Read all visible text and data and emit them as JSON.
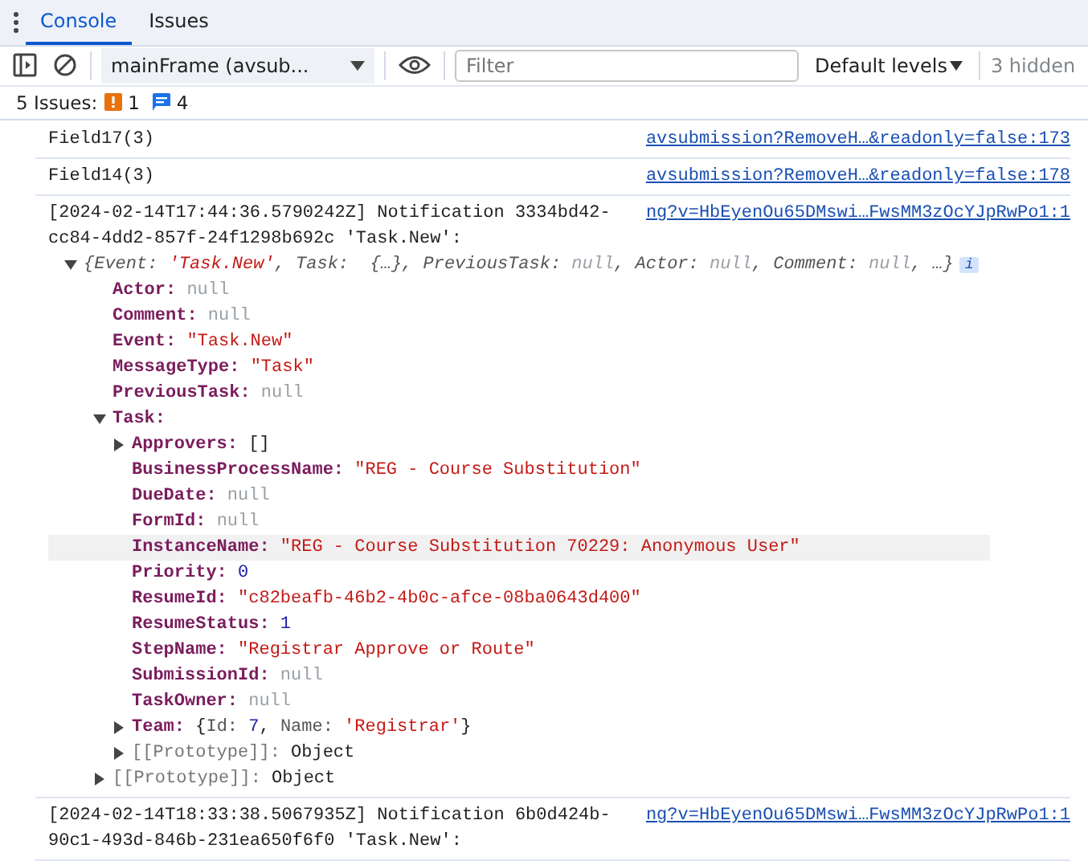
{
  "tabs": [
    {
      "label": "Console",
      "selected": true
    },
    {
      "label": "Issues",
      "selected": false
    }
  ],
  "toolbar": {
    "context": "mainFrame (avsub...",
    "filter_placeholder": "Filter",
    "levels": "Default levels",
    "hidden": "3 hidden"
  },
  "issues": {
    "label": "5 Issues:",
    "errors": "1",
    "infos": "4"
  },
  "messages": [
    {
      "kind": "log",
      "text": "Field17(3)",
      "source": "avsubmission?RemoveH…&readonly=false:173"
    },
    {
      "kind": "log",
      "text": "Field14(3)",
      "source": "avsubmission?RemoveH…&readonly=false:178"
    },
    {
      "kind": "object",
      "text": "[2024-02-14T17:44:36.5790242Z] Notification 3334bd42-cc84-4dd2-857f-24f1298b692c 'Task.New':",
      "source": "ng?v=HbEyenOu65DMswi…FwsMM3zOcYJpRwPo1:1",
      "expanded": true,
      "preview": [
        {
          "text": "{",
          "kind": "punct"
        },
        {
          "text": "Event:",
          "kind": "pkey"
        },
        {
          "text": "'Task.New'",
          "kind": "string"
        },
        {
          "text": ", ",
          "kind": "punct"
        },
        {
          "text": "Task:",
          "kind": "pkey"
        },
        {
          "text": " {…}, ",
          "kind": "punct"
        },
        {
          "text": "PreviousTask:",
          "kind": "pkey"
        },
        {
          "text": "null",
          "kind": "null"
        },
        {
          "text": ", ",
          "kind": "punct"
        },
        {
          "text": "Actor:",
          "kind": "pkey"
        },
        {
          "text": "null",
          "kind": "null"
        },
        {
          "text": ", ",
          "kind": "punct"
        },
        {
          "text": "Comment:",
          "kind": "pkey"
        },
        {
          "text": "null",
          "kind": "null"
        },
        {
          "text": ", …}",
          "kind": "punct"
        }
      ],
      "info_badge": "i",
      "tree": [
        {
          "key": "Actor:",
          "value": "null",
          "kind": "null"
        },
        {
          "key": "Comment:",
          "value": "null",
          "kind": "null"
        },
        {
          "key": "Event:",
          "value": "\"Task.New\"",
          "kind": "string"
        },
        {
          "key": "MessageType:",
          "value": "\"Task\"",
          "kind": "string"
        },
        {
          "key": "PreviousTask:",
          "value": "null",
          "kind": "null"
        },
        {
          "key": "Task:",
          "kind": "object",
          "expanded": true,
          "children": [
            {
              "key": "Approvers:",
              "value": "[]",
              "kind": "object",
              "expanded": false
            },
            {
              "key": "BusinessProcessName:",
              "value": "\"REG - Course Substitution\"",
              "kind": "string"
            },
            {
              "key": "DueDate:",
              "value": "null",
              "kind": "null"
            },
            {
              "key": "FormId:",
              "value": "null",
              "kind": "null"
            },
            {
              "key": "InstanceName:",
              "value": "\"REG - Course Substitution 70229: Anonymous User\"",
              "kind": "string",
              "highlighted": true
            },
            {
              "key": "Priority:",
              "value": "0",
              "kind": "number"
            },
            {
              "key": "ResumeId:",
              "value": "\"c82beafb-46b2-4b0c-afce-08ba0643d400\"",
              "kind": "string"
            },
            {
              "key": "ResumeStatus:",
              "value": "1",
              "kind": "number"
            },
            {
              "key": "StepName:",
              "value": "\"Registrar Approve or Route\"",
              "kind": "string"
            },
            {
              "key": "SubmissionId:",
              "value": "null",
              "kind": "null"
            },
            {
              "key": "TaskOwner:",
              "value": "null",
              "kind": "null"
            },
            {
              "key": "Team:",
              "kind": "object",
              "expanded": false,
              "parts": [
                {
                  "text": "{",
                  "kind": "punct"
                },
                {
                  "text": "Id:",
                  "kind": "pkey"
                },
                {
                  "text": "7",
                  "kind": "number"
                },
                {
                  "text": ", ",
                  "kind": "punct"
                },
                {
                  "text": "Name:",
                  "kind": "pkey"
                },
                {
                  "text": "'Registrar'",
                  "kind": "string"
                },
                {
                  "text": "}",
                  "kind": "punct"
                }
              ]
            },
            {
              "key": "[[Prototype]]:",
              "value": "Object",
              "kind": "proto",
              "expanded": false
            }
          ]
        },
        {
          "key": "[[Prototype]]:",
          "value": "Object",
          "kind": "proto",
          "expanded": false
        }
      ]
    },
    {
      "kind": "log",
      "text": "[2024-02-14T18:33:38.5067935Z] Notification 6b0d424b-90c1-493d-846b-231ea650f6f0 'Task.New':",
      "source": "ng?v=HbEyenOu65DMswi…FwsMM3zOcYJpRwPo1:1"
    }
  ]
}
